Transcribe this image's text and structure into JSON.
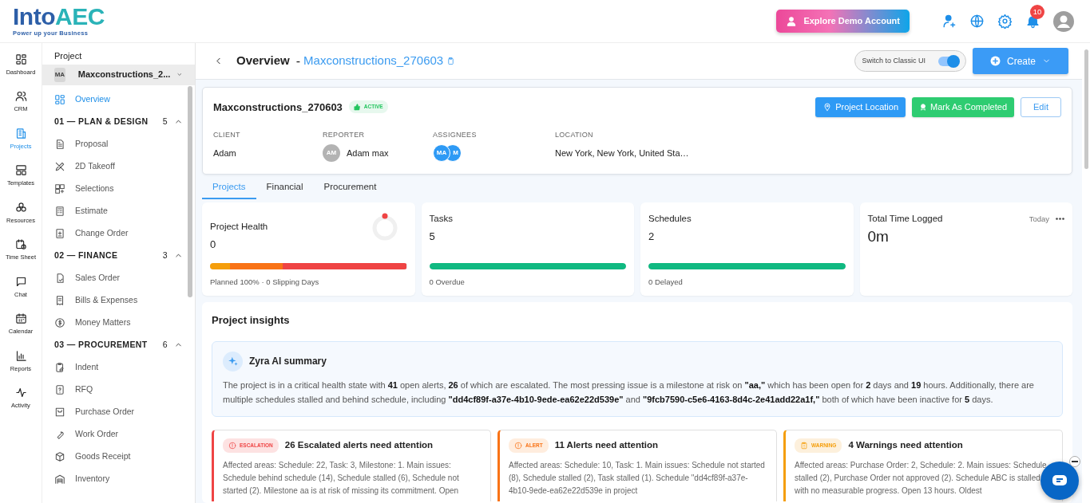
{
  "brand": {
    "name_start": "Into",
    "name_end": "AEC",
    "tagline": "Power up your Business"
  },
  "header": {
    "demo_button": "Explore Demo Account",
    "notification_count": "10"
  },
  "rail": [
    {
      "label": "Dashboard",
      "selected": false
    },
    {
      "label": "CRM",
      "selected": false
    },
    {
      "label": "Projects",
      "selected": true
    },
    {
      "label": "Templates",
      "selected": false
    },
    {
      "label": "Resources",
      "selected": false
    },
    {
      "label": "Time Sheet",
      "selected": false
    },
    {
      "label": "Chat",
      "selected": false
    },
    {
      "label": "Calendar",
      "selected": false
    },
    {
      "label": "Reports",
      "selected": false
    },
    {
      "label": "Activity",
      "selected": false
    }
  ],
  "project_sidebar": {
    "title": "Project",
    "avatar": "MA",
    "project": "Maxconstructions_2...",
    "items": [
      {
        "kind": "link",
        "label": "Overview",
        "selected": true
      },
      {
        "kind": "section",
        "label": "01 — PLAN & DESIGN",
        "count": "5",
        "expanded": true
      },
      {
        "kind": "link",
        "label": "Proposal",
        "selected": false
      },
      {
        "kind": "link",
        "label": "2D Takeoff",
        "selected": false
      },
      {
        "kind": "link",
        "label": "Selections",
        "selected": false
      },
      {
        "kind": "link",
        "label": "Estimate",
        "selected": false
      },
      {
        "kind": "link",
        "label": "Change Order",
        "selected": false
      },
      {
        "kind": "section",
        "label": "02 — FINANCE",
        "count": "3",
        "expanded": true
      },
      {
        "kind": "link",
        "label": "Sales Order",
        "selected": false
      },
      {
        "kind": "link",
        "label": "Bills & Expenses",
        "selected": false
      },
      {
        "kind": "link",
        "label": "Money Matters",
        "selected": false
      },
      {
        "kind": "section",
        "label": "03 — PROCUREMENT",
        "count": "6",
        "expanded": true
      },
      {
        "kind": "link",
        "label": "Indent",
        "selected": false
      },
      {
        "kind": "link",
        "label": "RFQ",
        "selected": false
      },
      {
        "kind": "link",
        "label": "Purchase Order",
        "selected": false
      },
      {
        "kind": "link",
        "label": "Work Order",
        "selected": false
      },
      {
        "kind": "link",
        "label": "Goods Receipt",
        "selected": false
      },
      {
        "kind": "link",
        "label": "Inventory",
        "selected": false
      }
    ]
  },
  "page": {
    "title": "Overview",
    "separator": "-",
    "project": "Maxconstructions_270603",
    "classic_toggle": {
      "label": "Switch to Classic UI",
      "on": true
    },
    "create_button": "Create"
  },
  "project_card": {
    "name": "Maxconstructions_270603",
    "status": "ACTIVE",
    "buttons": [
      {
        "kind": "location",
        "label": "Project Location"
      },
      {
        "kind": "complete",
        "label": "Mark As Completed"
      },
      {
        "kind": "edit",
        "label": "Edit"
      }
    ],
    "fields": [
      {
        "label": "CLIENT",
        "value": "Adam"
      },
      {
        "label": "REPORTER",
        "avatar": "AM",
        "value": "Adam max"
      },
      {
        "label": "ASSIGNEES",
        "avatars": [
          "MA",
          "M"
        ]
      },
      {
        "label": "LOCATION",
        "value": "New York, New York, United Sta…"
      }
    ]
  },
  "tabs": [
    {
      "label": "Projects",
      "selected": true
    },
    {
      "label": "Financial",
      "selected": false
    },
    {
      "label": "Procurement",
      "selected": false
    }
  ],
  "stats": [
    {
      "kind": "health",
      "title": "Project Health",
      "value": "0",
      "footer": "Planned 100% · 0 Slipping Days",
      "segments": [
        {
          "color": "#f59e0b",
          "level": 0.1
        },
        {
          "color": "#f97316",
          "level": 0.27
        },
        {
          "color": "#ef4444",
          "level": 0.63
        }
      ]
    },
    {
      "kind": "bar",
      "title": "Tasks",
      "value": "5",
      "level": 1,
      "footer": "0 Overdue"
    },
    {
      "kind": "bar",
      "title": "Schedules",
      "value": "2",
      "level": 1,
      "footer": "0 Delayed"
    },
    {
      "kind": "time",
      "title": "Total Time Logged",
      "value": "0m",
      "period": "Today"
    }
  ],
  "insights": {
    "title": "Project insights",
    "summary": {
      "title": "Zyra AI summary",
      "text": "The project is in a critical health state with **41** open alerts, **26** of which are escalated. The most pressing issue is a milestone at risk on **\"aa,\"** which has been open for **2** days and **19** hours. Additionally, there are multiple schedules stalled and behind schedule, including **\"dd4cf89f-a37e-4b10-9ede-ea62e22d539e\"** and **\"9fcb7590-c5e6-4163-8d4c-2e41add22a1f,\"** both of which have been inactive for **5** days."
    },
    "alerts": [
      {
        "kind": "escalation",
        "badge": "ESCALATION",
        "title": "26 Escalated alerts need attention",
        "text": "Affected areas: Schedule: 22, Task: 3, Milestone: 1. Main issues: Schedule behind schedule (14), Schedule stalled (6), Schedule not started (2). Milestone aa is at risk of missing its commitment. Open"
      },
      {
        "kind": "alert",
        "badge": "ALERT",
        "title": "11 Alerts need attention",
        "text": "Affected areas: Schedule: 10, Task: 1. Main issues: Schedule not started (8), Schedule stalled (2), Task stalled (1). Schedule \"dd4cf89f-a37e-4b10-9ede-ea62e22d539e in project"
      },
      {
        "kind": "warning",
        "badge": "WARNING",
        "title": "4 Warnings need attention",
        "text": "Affected areas: Purchase Order: 2, Schedule: 2. Main issues: Schedule stalled (2), Purchase Order not approved (2). Schedule ABC is stalled with no measurable progress. Open 13 hours. Oldest"
      }
    ]
  }
}
